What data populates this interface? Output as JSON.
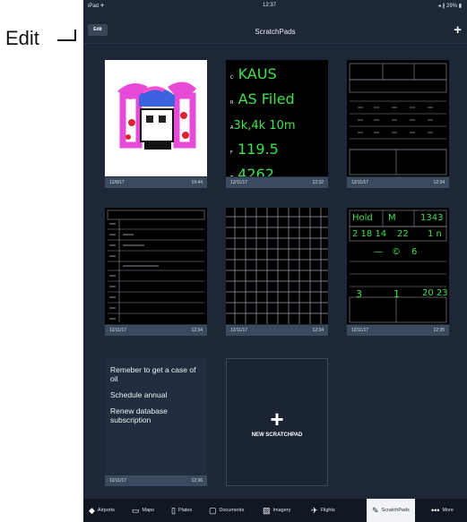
{
  "annotation": {
    "label": "Edit"
  },
  "status": {
    "left": "iPad ✈",
    "time": "12:37",
    "right": "◂ ∦ 29% ▮"
  },
  "nav": {
    "title": "ScratchPads",
    "edit_label": "Edit",
    "add_icon": "plus-icon"
  },
  "cards": [
    {
      "date": "12/8/17",
      "time": "19:44"
    },
    {
      "date": "12/11/17",
      "time": "12:32"
    },
    {
      "date": "12/11/17",
      "time": "12:34"
    },
    {
      "date": "12/11/17",
      "time": "12:34"
    },
    {
      "date": "12/11/17",
      "time": "12:34"
    },
    {
      "date": "12/11/17",
      "time": "12:35"
    },
    {
      "date": "12/11/17",
      "time": "12:36"
    }
  ],
  "notes": {
    "lines": [
      "Remeber to get a case of oil",
      "Schedule annual",
      "Renew database subscription"
    ]
  },
  "handwriting": {
    "craft": [
      {
        "prefix": "C",
        "text": "KAUS"
      },
      {
        "prefix": "R",
        "text": "AS Filed"
      },
      {
        "prefix": "A",
        "text": "3k,4k 10m"
      },
      {
        "prefix": "F",
        "text": "119.5"
      },
      {
        "prefix": "T",
        "text": "4262"
      }
    ],
    "atis": {
      "row1": [
        "Hold",
        "M",
        "1343"
      ],
      "row2": [
        "2 18 14",
        "22",
        "1 n"
      ],
      "row3": [
        "—",
        "©",
        "6"
      ],
      "row4": [
        "3",
        "1",
        "20 23"
      ]
    }
  },
  "new_pad": {
    "label": "NEW SCRATCHPAD"
  },
  "tabs": [
    {
      "label": "Airports",
      "icon": "airports-icon"
    },
    {
      "label": "Maps",
      "icon": "maps-icon"
    },
    {
      "label": "Plates",
      "icon": "plates-icon"
    },
    {
      "label": "Documents",
      "icon": "documents-icon"
    },
    {
      "label": "Imagery",
      "icon": "imagery-icon"
    },
    {
      "label": "Flights",
      "icon": "flights-icon"
    },
    {
      "label": "ScratchPads",
      "icon": "scratchpads-icon",
      "active": true
    },
    {
      "label": "More",
      "icon": "more-icon"
    }
  ]
}
